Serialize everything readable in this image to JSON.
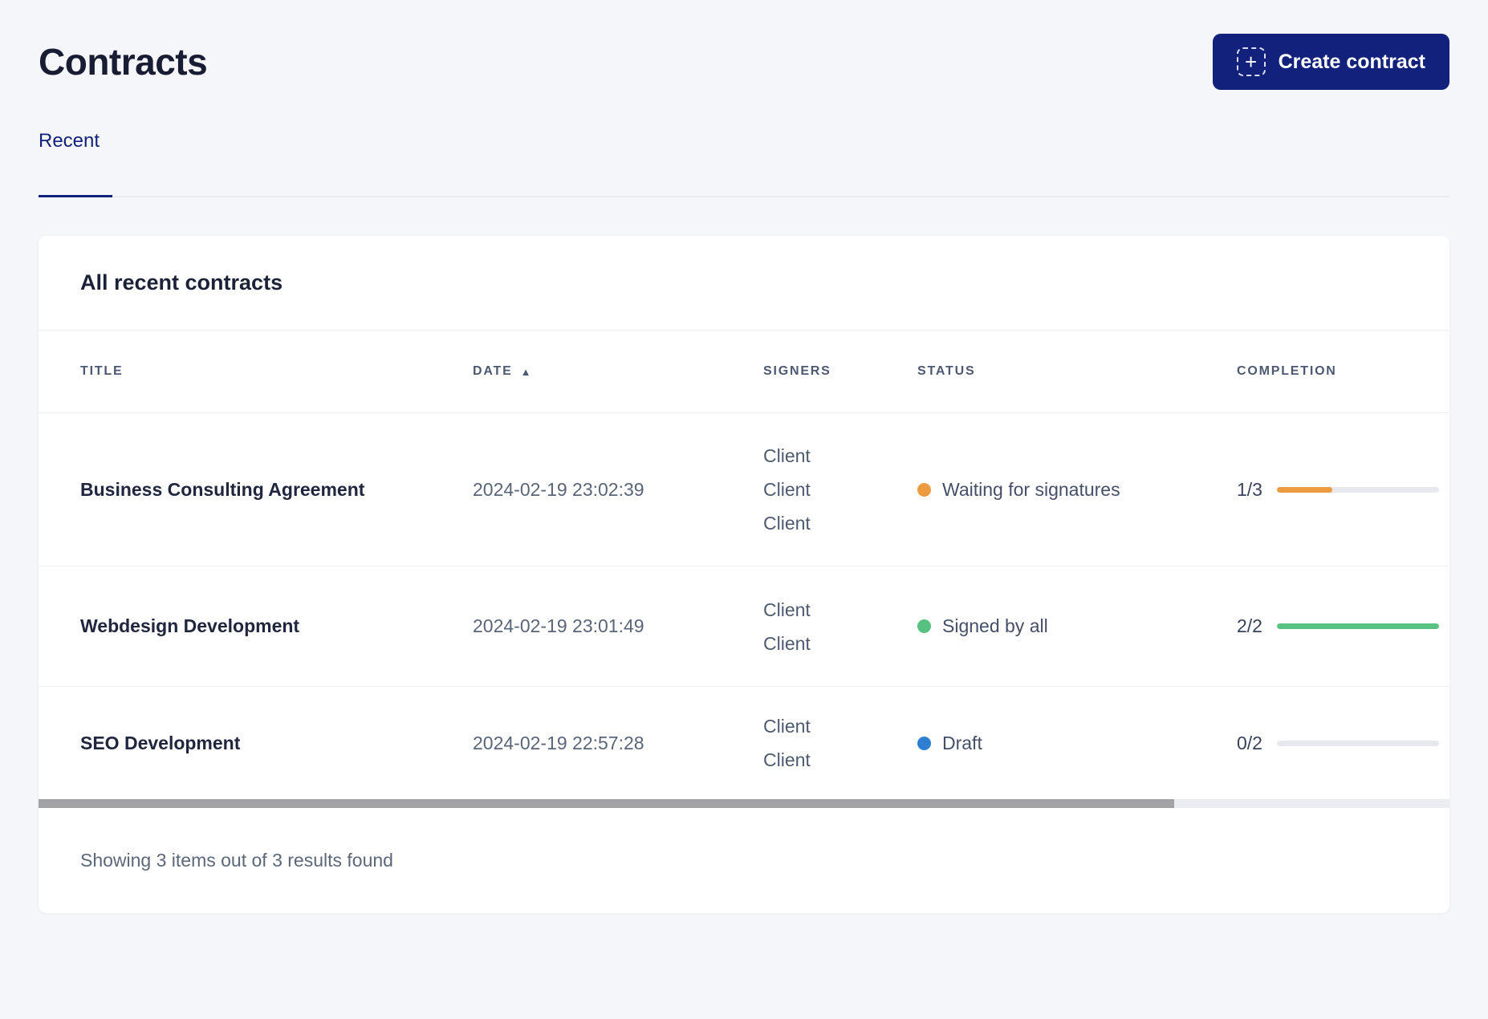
{
  "page": {
    "title": "Contracts"
  },
  "header": {
    "create_button": {
      "label": "Create contract",
      "color": "#12217b"
    }
  },
  "icons": {
    "plus": "+",
    "sort_asc": "▲"
  },
  "tabs": [
    {
      "label": "Recent",
      "active": true
    }
  ],
  "card": {
    "title": "All recent contracts",
    "columns": [
      "Title",
      "Date",
      "Signers",
      "Status",
      "Completion"
    ],
    "sort": {
      "column": "Date",
      "direction": "ascending"
    },
    "rows": [
      {
        "title": "Business Consulting Agreement",
        "date": "2024-02-19 23:02:39",
        "signers": [
          "Client",
          "Client",
          "Client"
        ],
        "status": {
          "label": "Waiting for signatures",
          "color": "#ed9b40"
        },
        "completion": {
          "label": "1/3",
          "fraction": 0.34,
          "color": "#ed9b40"
        }
      },
      {
        "title": "Webdesign Development",
        "date": "2024-02-19 23:01:49",
        "signers": [
          "Client",
          "Client"
        ],
        "status": {
          "label": "Signed by all",
          "color": "#57c181"
        },
        "completion": {
          "label": "2/2",
          "fraction": 1,
          "color": "#57c181"
        }
      },
      {
        "title": "SEO Development",
        "date": "2024-02-19 22:57:28",
        "signers": [
          "Client",
          "Client"
        ],
        "status": {
          "label": "Draft",
          "color": "#2e7fd2"
        },
        "completion": {
          "label": "0/2",
          "fraction": 0,
          "color": "#2e7fd2"
        }
      }
    ],
    "footer": "Showing 3 items out of 3 results found"
  }
}
